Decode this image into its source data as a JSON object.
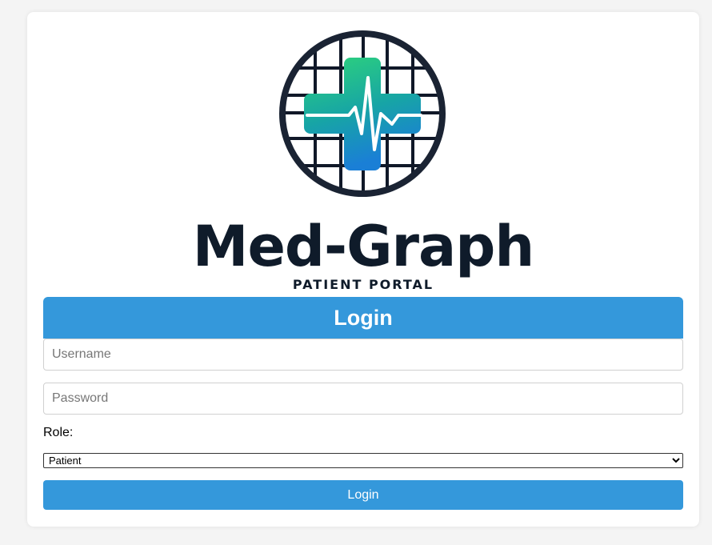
{
  "logo": {
    "brand_name": "Med-Graph",
    "tagline": "PATIENT PORTAL",
    "icon": "medical-cross-heartbeat-icon"
  },
  "login_form": {
    "title": "Login",
    "username_placeholder": "Username",
    "password_placeholder": "Password",
    "role_label": "Role:",
    "role_selected": "Patient",
    "submit_label": "Login"
  },
  "colors": {
    "accent": "#3498db",
    "brand_dark": "#0f1b2a",
    "cross_green": "#2ed47a",
    "cross_blue": "#1a7fd6"
  }
}
